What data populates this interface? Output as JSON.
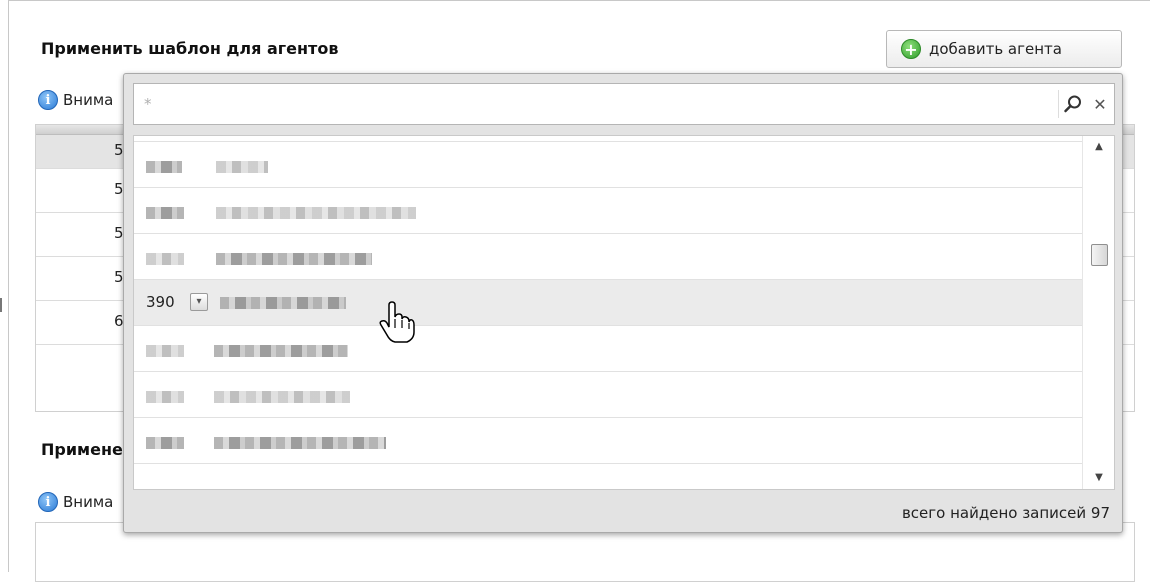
{
  "section1": {
    "title": "Применить шаблон для агентов",
    "info_text": "Внима"
  },
  "section2": {
    "title": "Примене",
    "info_text": "Внима"
  },
  "add_button": {
    "label": "добавить агента"
  },
  "background_table": {
    "row_codes": [
      "5",
      "5",
      "5",
      "5",
      "6"
    ]
  },
  "dropdown": {
    "search": {
      "value": "",
      "placeholder": "*"
    },
    "hover_item": {
      "code": "390"
    },
    "footer": {
      "records_text": "всего найдено записей 97"
    }
  },
  "icons": {
    "add": "plus-circle-icon",
    "info": "info-icon",
    "search": "magnifier-icon",
    "clear": "close-icon",
    "cursor": "hand-pointer-icon"
  },
  "colors": {
    "add_green": "#2f9c2b",
    "info_blue": "#2a7ad6",
    "hover_row": "#ebebeb",
    "popup_bg": "#e3e3e3"
  }
}
